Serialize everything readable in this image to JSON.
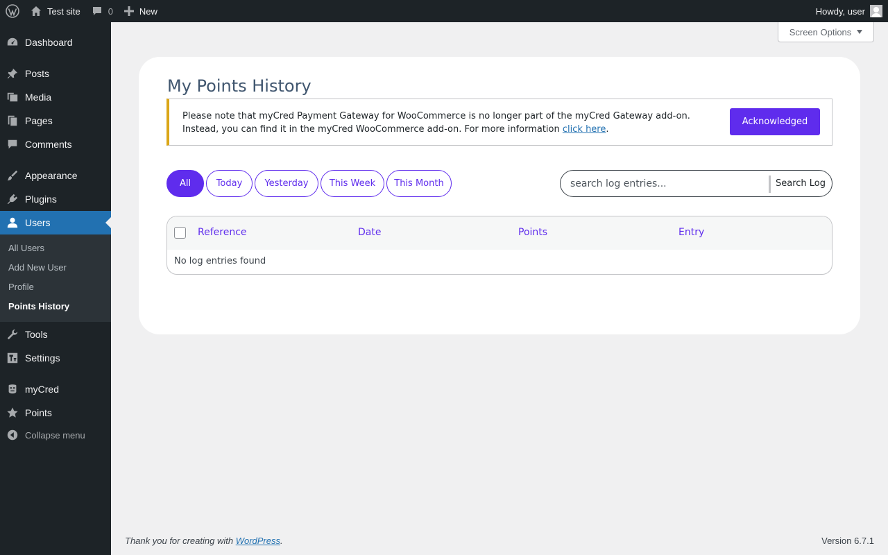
{
  "adminbar": {
    "site_name": "Test site",
    "comments_count": "0",
    "new_label": "New",
    "greeting": "Howdy, user"
  },
  "sidebar": {
    "items": [
      {
        "label": "Dashboard",
        "icon": "dashboard-icon"
      },
      {
        "label": "Posts",
        "icon": "pushpin-icon"
      },
      {
        "label": "Media",
        "icon": "media-icon"
      },
      {
        "label": "Pages",
        "icon": "pages-icon"
      },
      {
        "label": "Comments",
        "icon": "comment-icon"
      },
      {
        "label": "Appearance",
        "icon": "paintbrush-icon"
      },
      {
        "label": "Plugins",
        "icon": "plugin-icon"
      },
      {
        "label": "Users",
        "icon": "user-icon"
      },
      {
        "label": "Tools",
        "icon": "wrench-icon"
      },
      {
        "label": "Settings",
        "icon": "settings-icon"
      },
      {
        "label": "myCred",
        "icon": "mycred-icon"
      },
      {
        "label": "Points",
        "icon": "star-icon"
      }
    ],
    "submenu": [
      "All Users",
      "Add New User",
      "Profile",
      "Points History"
    ],
    "collapse_label": "Collapse menu"
  },
  "screen_options_label": "Screen Options",
  "page": {
    "title": "My Points History",
    "notice_line1": "Please note that myCred Payment Gateway for WooCommerce is no longer part of the myCred Gateway add-on.",
    "notice_line2": "Instead, you can find it in the myCred WooCommerce add-on. For more information",
    "notice_link": "click here",
    "notice_end": ".",
    "ack_label": "Acknowledged",
    "filters": [
      "All",
      "Today",
      "Yesterday",
      "This Week",
      "This Month"
    ],
    "search_placeholder": "search log entries...",
    "search_button": "Search Log",
    "columns": [
      "Reference",
      "Date",
      "Points",
      "Entry"
    ],
    "empty_message": "No log entries found"
  },
  "footer": {
    "thanks_prefix": "Thank you for creating with ",
    "thanks_link": "WordPress",
    "thanks_suffix": ".",
    "version": "Version 6.7.1"
  },
  "colors": {
    "accent": "#5f2ced",
    "admin_bg": "#1d2327",
    "current_menu": "#2271b1",
    "notice_border": "#dba617"
  }
}
